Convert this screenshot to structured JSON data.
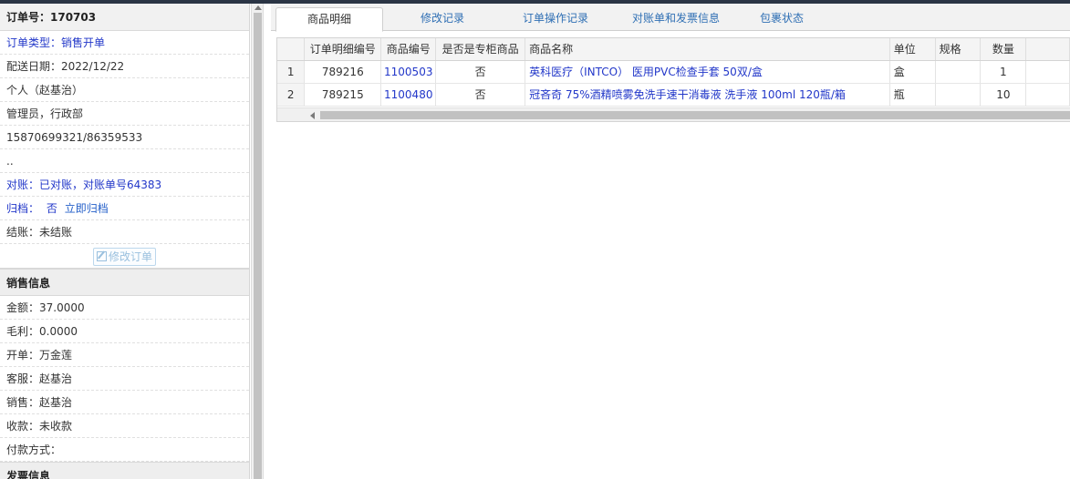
{
  "order": {
    "title": "订单号：170703",
    "type": "订单类型：销售开单",
    "delivery_date": "配送日期：2022/12/22",
    "customer": "个人（赵基治）",
    "dept": "管理员，行政部",
    "phone": "15870699321/86359533",
    "address": "..",
    "reconcile": "对账：已对账，对账单号64383",
    "archive_label": "归档：",
    "archive_value": "否",
    "archive_action": "立即归档",
    "settlement": "结账：未结账",
    "edit_button": "修改订单"
  },
  "sales": {
    "title": "销售信息",
    "amount": "金额：37.0000",
    "profit": "毛利：0.0000",
    "creator": "开单：万金莲",
    "service": "客服：赵基治",
    "salesperson": "销售：赵基治",
    "payment_status": "收款：未收款",
    "payment_method": "付款方式："
  },
  "invoice": {
    "title": "发票信息"
  },
  "tabs": [
    {
      "label": "商品明细",
      "active": true
    },
    {
      "label": "修改记录"
    },
    {
      "label": "订单操作记录"
    },
    {
      "label": "对账单和发票信息"
    },
    {
      "label": "包裹状态"
    }
  ],
  "table": {
    "headers": [
      "订单明细编号",
      "商品编号",
      "是否是专柜商品",
      "商品名称",
      "单位",
      "规格",
      "数量"
    ],
    "rows": [
      {
        "num": "1",
        "detail_id": "789216",
        "product_id": "1100503",
        "counter": "否",
        "name": "英科医疗（INTCO） 医用PVC检查手套 50双/盒",
        "unit": "盒",
        "spec": "",
        "qty": "1"
      },
      {
        "num": "2",
        "detail_id": "789215",
        "product_id": "1100480",
        "counter": "否",
        "name": "冠吝奇 75%酒精喷雾免洗手速干消毒液 洗手液 100ml 120瓶/箱",
        "unit": "瓶",
        "spec": "",
        "qty": "10"
      }
    ]
  },
  "colors": {
    "link": "#2237c9",
    "tab_link": "#2f6fb4",
    "header_bg": "#f1f1f1"
  }
}
